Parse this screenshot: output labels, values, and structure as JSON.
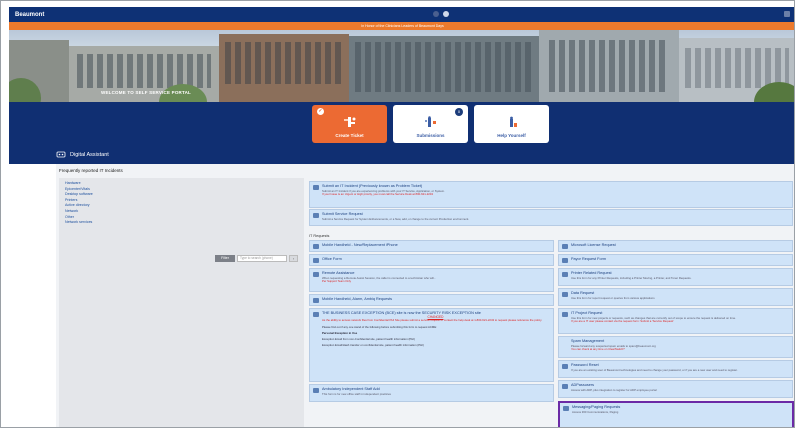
{
  "header": {
    "brand": "Beaumont",
    "banner": "In Honor of the Clinicians Leaders of Beaumont Days"
  },
  "hero": {
    "welcome": "WELCOME TO SELF SERVICE PORTAL"
  },
  "tiles": [
    {
      "label": "Create Ticket"
    },
    {
      "label": "Submissions",
      "badge": "0"
    },
    {
      "label": "Help Yourself"
    }
  ],
  "assistant": {
    "title": "Digital Assistant"
  },
  "frequent": {
    "heading": "Frequently reported IT Incidents",
    "items": [
      "Hardware",
      "Epicenter/Vitals",
      "Desktop software",
      "Printers",
      "Active directory",
      "Network",
      "Other",
      "Network services"
    ],
    "filter_label": "Filter",
    "search_placeholder": "Type to search (phone)",
    "search_button": "›"
  },
  "top_cards": [
    {
      "title": "Submit an IT Incident (Previously known as Problem Ticket)",
      "desc": "Submit an IT Incident if you are experiencing problems with your IT Service, Application, or System.",
      "note": "If your Issue is an Urgent or High priority, you must call the Service Desk at 800-621-2243"
    },
    {
      "title": "Submit Service Request",
      "desc": "Submit a Service Request for System Enhancements, or a New, add, or change to the current Production environment."
    }
  ],
  "requests_heading": "IT Requests",
  "left_cards": [
    {
      "title": "Mobile Handheld - New/Replacement iPhone"
    },
    {
      "title": "Office Form"
    },
    {
      "title": "Remote Assistance",
      "desc": "When requesting a Remote Assist Session, the caller is connected to a technician who will...",
      "note": "Per Support Team Only"
    },
    {
      "title": "Mobile Handheld, Alarm, Ambiq Requests"
    },
    {
      "title": "THE BUSINESS CASE EXCEPTION (BCE) site is now the SECURITY RISK EXCEPTION site",
      "link": "CHANGED",
      "note": "As the ability to access network files from Confidential PHI Site please submit a service request or contact the help desk at 1-800-621-2243 to request please reference the policy.",
      "para": "Please find out if any one stand of the following before submitting this form to request ACME:",
      "rules": [
        "Personal Exception in Use",
        "Exception Email from non-Confidential site, patient health information (PHI)",
        "Exception Email/Hash transfer on confidential site, patient health information (PHI)"
      ]
    },
    {
      "title": "Ambulatory Independent Staff Add",
      "desc": "This form is for new office staff in independent practices"
    }
  ],
  "right_cards": [
    {
      "title": "Microsoft License Request"
    },
    {
      "title": "Payor Request Form"
    },
    {
      "title": "Printer Related Request",
      "desc": "Use this form for any Printer Requests, including a Printer Moving, a Printer, and Toner Requests."
    },
    {
      "title": "Data Request",
      "desc": "Use this form for report request or queries from various applications"
    },
    {
      "title": "IT Project Request",
      "desc": "Use this form for new projects or requests, such as changes that are currently out of scope to ensure the request is delivered on time.",
      "note": "If you are a IT user please contact via the request form: Submit a 'Service Request'"
    },
    {
      "title": "Spam Management",
      "desc": "Please forward any suspected spam emails to spam@beaumont.org",
      "note": "You can check at any time on ClearSwitch?"
    },
    {
      "title": "Password Reset",
      "desc": "If you are an existing user of Beaumont technologies and need to change your password, or if you are a new user and need to register."
    },
    {
      "title": "ADPassusers",
      "desc": "Access with ADP, plus integration to register for ADP employee portal"
    },
    {
      "title": "Messaging/Paging Requests",
      "desc": "Access 360 Communications, Paging"
    }
  ]
}
